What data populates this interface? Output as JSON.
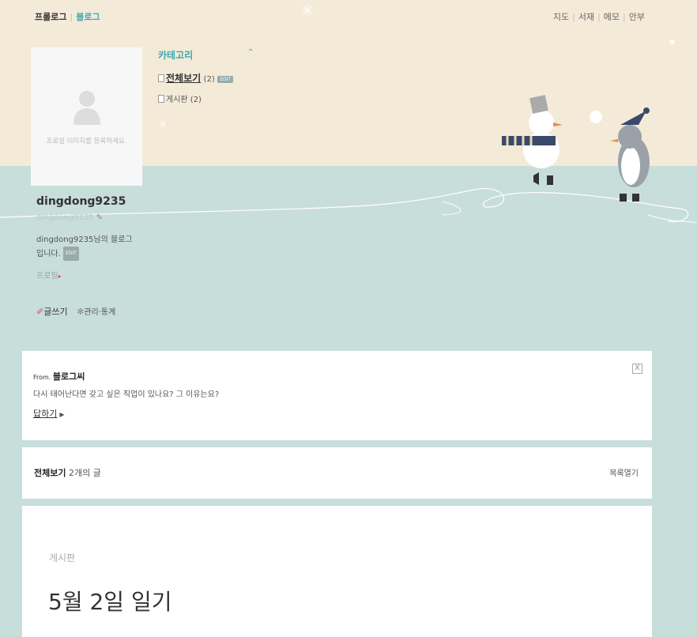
{
  "topnav": {
    "prologue": "프롤로그",
    "blog": "블로그",
    "right": [
      "지도",
      "서재",
      "메모",
      "안부"
    ]
  },
  "profile": {
    "image_hint": "프로필 이미지를 등록하세요.",
    "blog_id": "dingdong9235",
    "sub_id": "dingdong9235",
    "desc_line1": "dingdong9235님의 블로그",
    "desc_line2": "입니다.",
    "edit_badge": "EDIT",
    "profile_link": "프로필",
    "write": "글쓰기",
    "admin": "관리·통계"
  },
  "category": {
    "title": "카테고리",
    "toggle": "⌃",
    "items": [
      {
        "label": "전체보기",
        "count": "(2)",
        "badge": "EDIT"
      },
      {
        "label": "게시판",
        "count": "(2)"
      }
    ]
  },
  "question": {
    "from_label": "From.",
    "from_name": "블로그씨",
    "text": "다시 태어난다면 갖고 싶은 직업이 있나요? 그 이유는요?",
    "reply": "답하기",
    "close": "X"
  },
  "post_list": {
    "title": "전체보기",
    "count": "2개의 글",
    "open": "목록열기"
  },
  "post": {
    "category": "게시판",
    "title": "5월 2일 일기"
  },
  "colors": {
    "accent": "#3da7b3",
    "top_bg": "#f4ead8",
    "bottom_bg": "#c8dedb"
  }
}
